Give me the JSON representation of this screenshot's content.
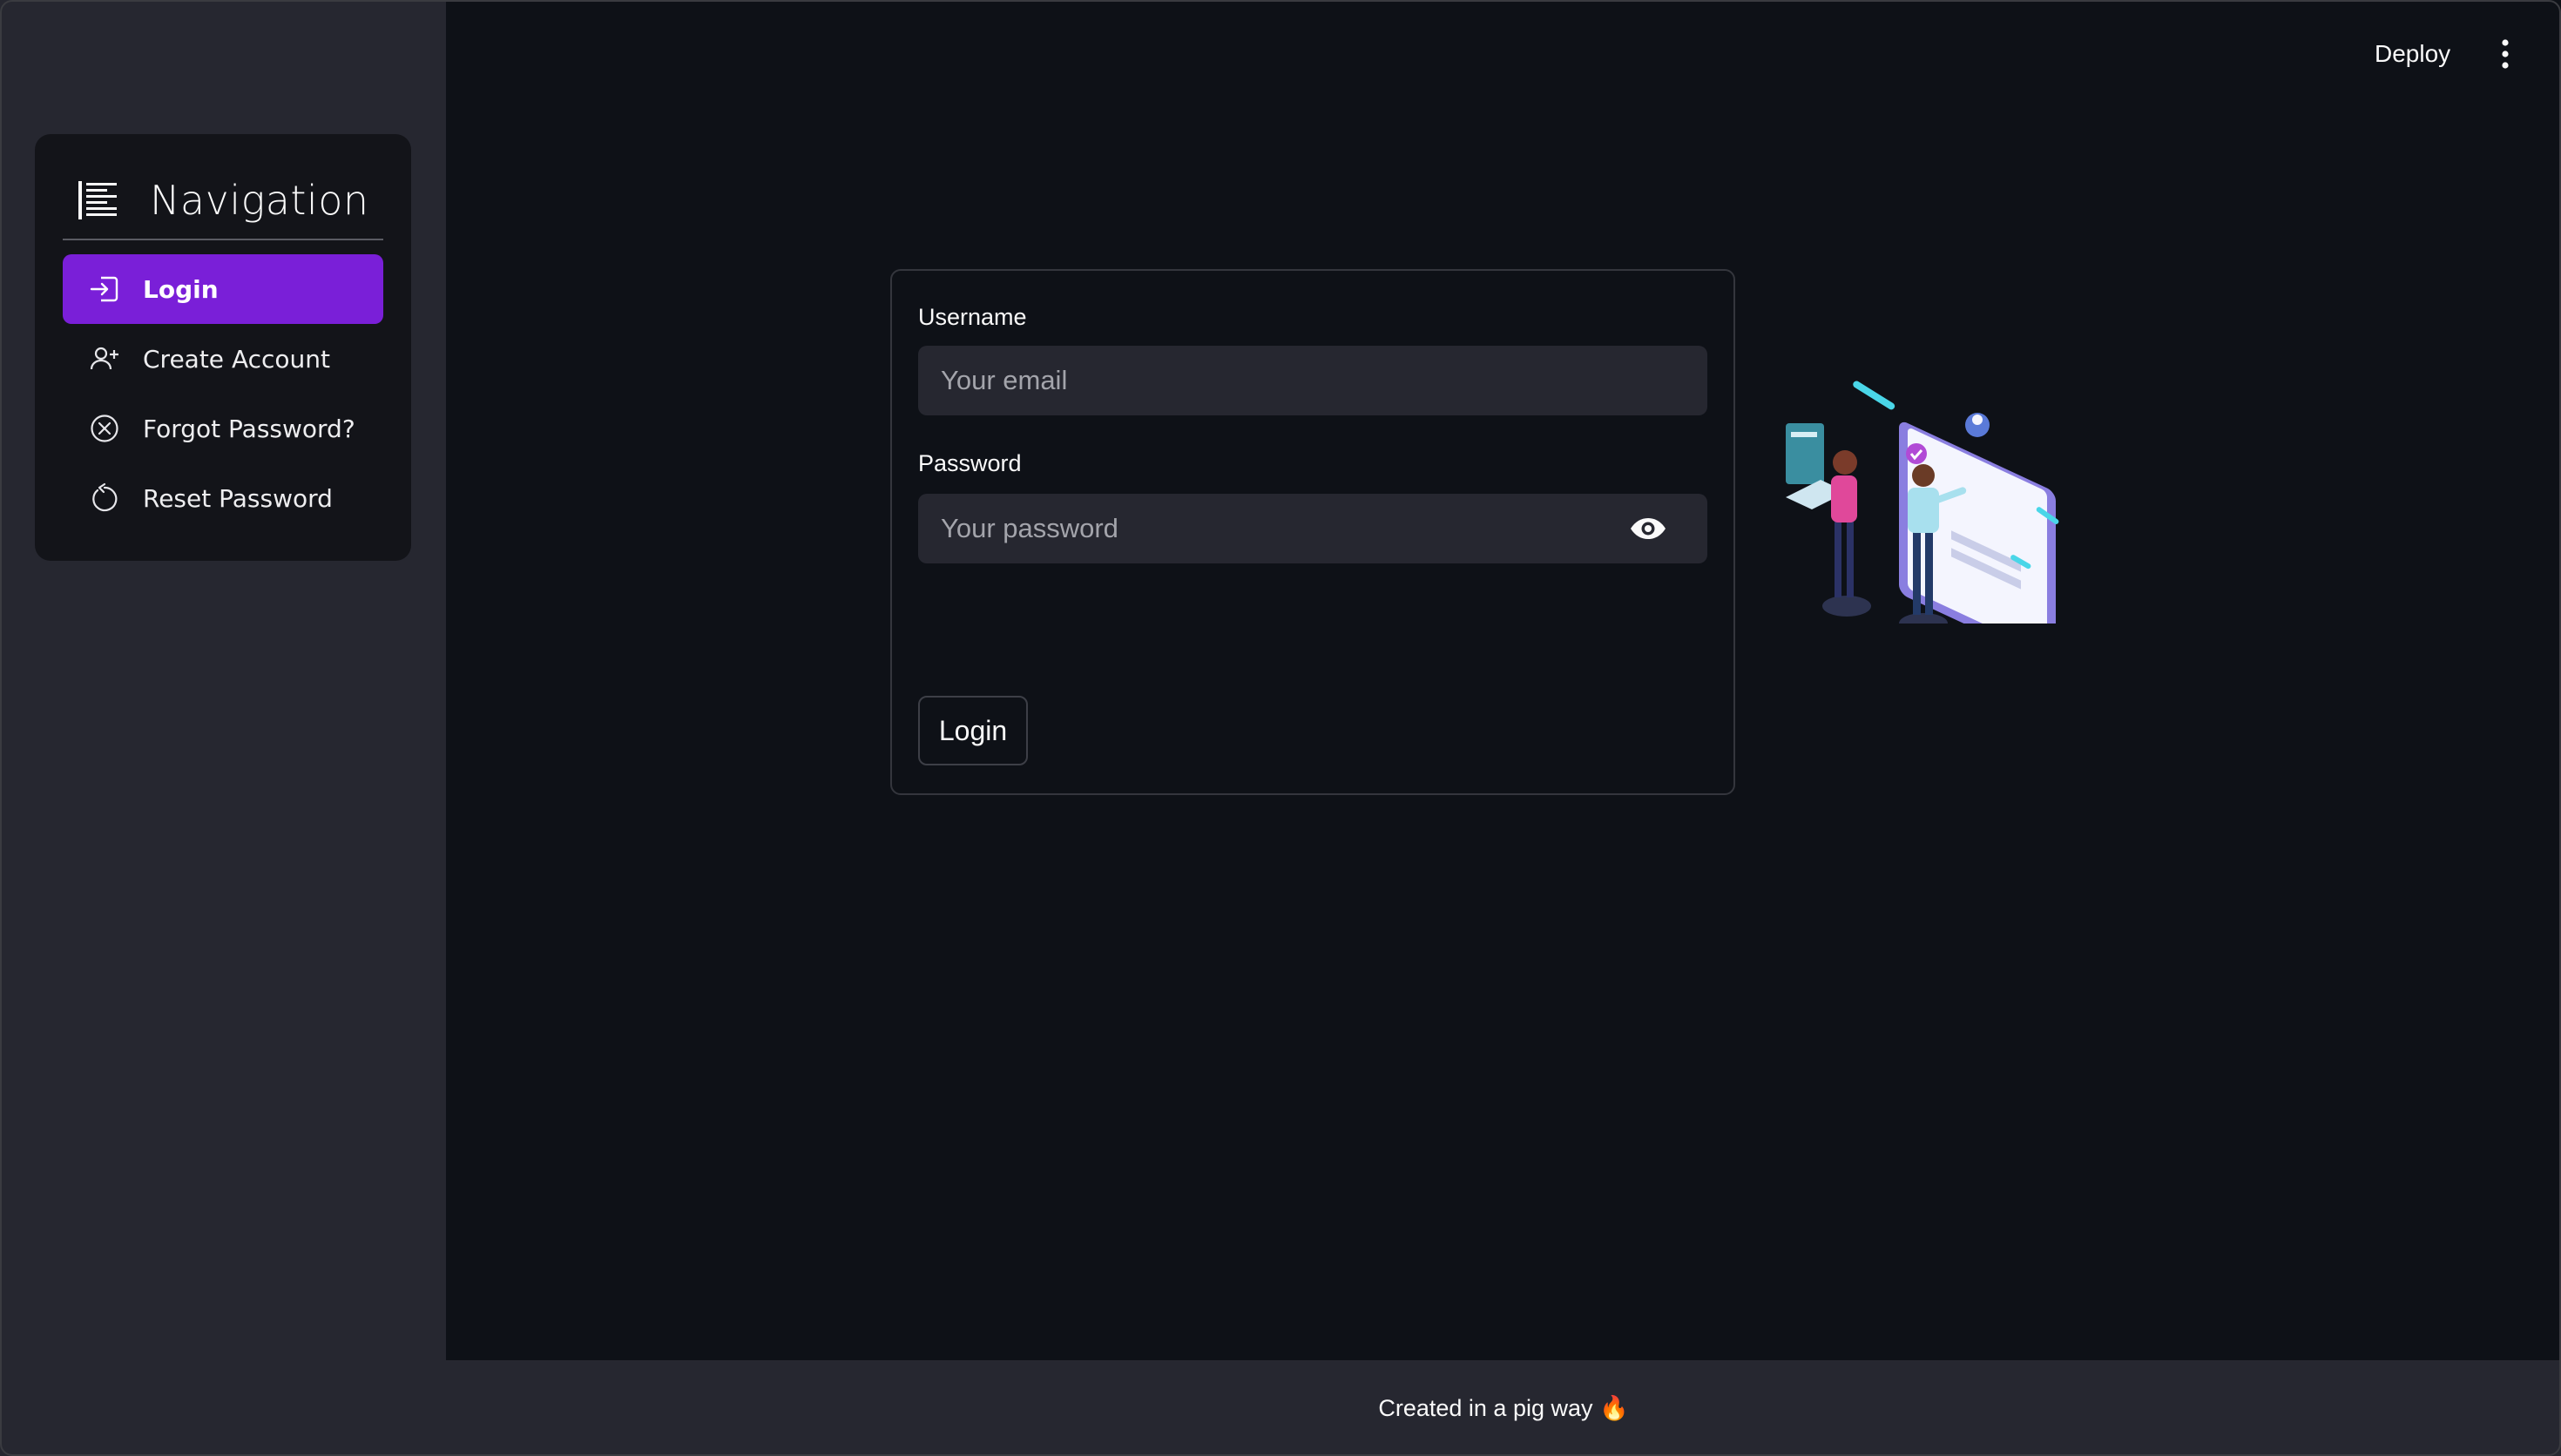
{
  "sidebar": {
    "title": "Navigation",
    "items": [
      {
        "label": "Login",
        "icon": "login-icon",
        "active": true
      },
      {
        "label": "Create Account",
        "icon": "person-add-icon",
        "active": false
      },
      {
        "label": "Forgot Password?",
        "icon": "x-circle-icon",
        "active": false
      },
      {
        "label": "Reset Password",
        "icon": "arrow-counterclockwise-icon",
        "active": false
      }
    ]
  },
  "topbar": {
    "deploy_label": "Deploy",
    "menu_icon": "vertical-dots-icon"
  },
  "form": {
    "username_label": "Username",
    "username_placeholder": "Your email",
    "username_value": "",
    "password_label": "Password",
    "password_placeholder": "Your password",
    "password_value": "",
    "submit_label": "Login"
  },
  "footer": {
    "text": "Created in a pig way 🔥"
  },
  "colors": {
    "accent": "#7a1fd8",
    "background": "#0e1117",
    "sidebar": "#262730"
  }
}
